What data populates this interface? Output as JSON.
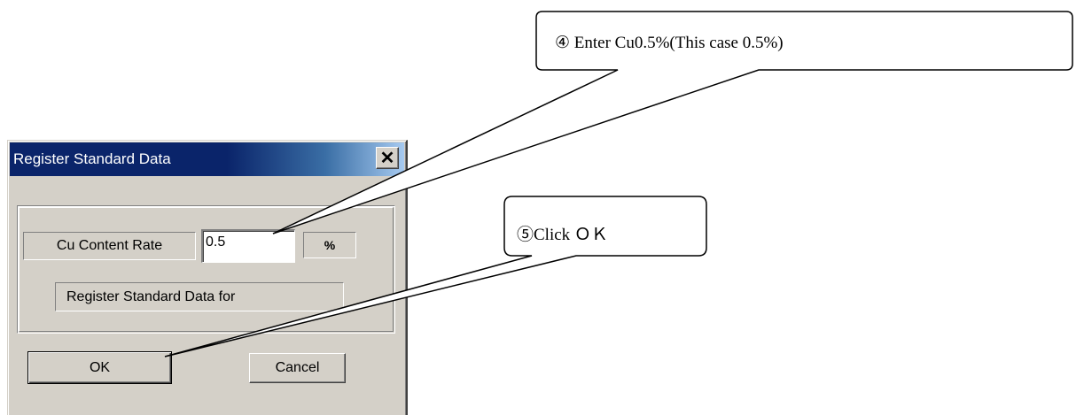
{
  "dialog": {
    "title": "Register Standard Data",
    "close_glyph": "✕",
    "cu_label": "Cu Content Rate",
    "cu_value": "0.5",
    "unit": "%",
    "register_label": "Register Standard Data for",
    "ok_label": "OK",
    "cancel_label": "Cancel"
  },
  "callouts": {
    "step4": "④ Enter Cu0.5%(This case 0.5%)",
    "step5": "⑤Click ＯＫ"
  },
  "colors": {
    "titlebar": "#0a246a",
    "dialog_face": "#d4d0c8"
  }
}
